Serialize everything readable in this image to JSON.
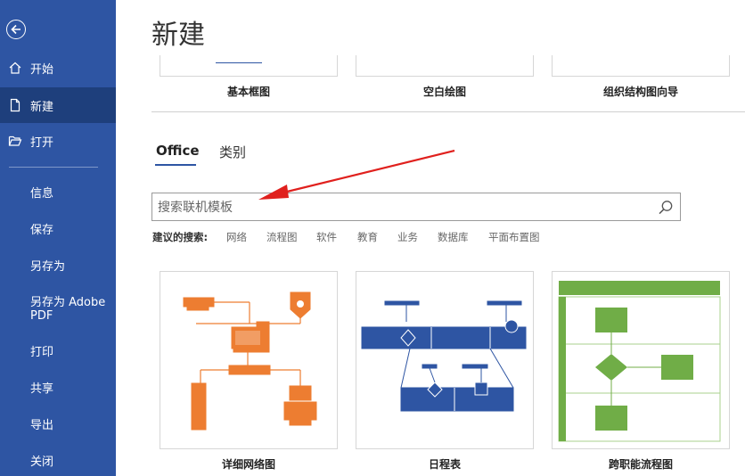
{
  "sidebar": {
    "back_icon": "back-arrow-icon",
    "items": [
      {
        "label": "开始",
        "icon": "home-icon"
      },
      {
        "label": "新建",
        "icon": "new-document-icon"
      },
      {
        "label": "打开",
        "icon": "open-folder-icon"
      },
      {
        "label": "信息"
      },
      {
        "label": "保存"
      },
      {
        "label": "另存为"
      },
      {
        "label": "另存为 Adobe PDF"
      },
      {
        "label": "打印"
      },
      {
        "label": "共享"
      },
      {
        "label": "导出"
      },
      {
        "label": "关闭"
      }
    ],
    "colors": {
      "background": "#2e55a3",
      "active": "#1e3f7c"
    }
  },
  "main": {
    "title": "新建",
    "top_templates": [
      {
        "label": "基本框图"
      },
      {
        "label": "空白绘图"
      },
      {
        "label": "组织结构图向导"
      }
    ],
    "tabs": [
      {
        "label": "Office"
      },
      {
        "label": "类别"
      }
    ],
    "search": {
      "placeholder": "搜索联机模板"
    },
    "suggestions": {
      "label": "建议的搜索:",
      "items": [
        "网络",
        "流程图",
        "软件",
        "教育",
        "业务",
        "数据库",
        "平面布置图"
      ]
    },
    "templates": [
      {
        "label": "详细网络图",
        "accent": "#ed7d31"
      },
      {
        "label": "日程表",
        "accent": "#2e55a3"
      },
      {
        "label": "跨职能流程图",
        "accent": "#70ad47"
      }
    ]
  }
}
